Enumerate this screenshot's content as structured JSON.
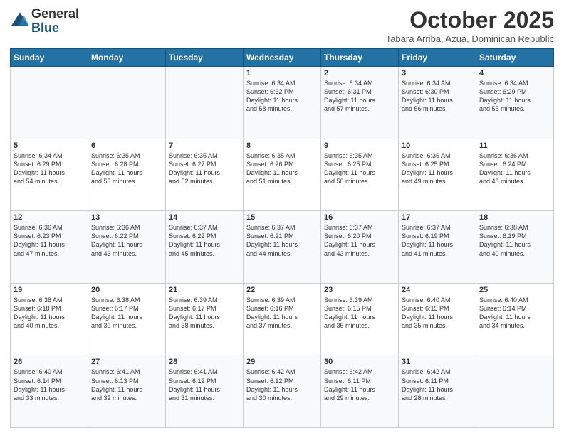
{
  "header": {
    "logo_general": "General",
    "logo_blue": "Blue",
    "month_title": "October 2025",
    "subtitle": "Tabara Arriba, Azua, Dominican Republic"
  },
  "weekdays": [
    "Sunday",
    "Monday",
    "Tuesday",
    "Wednesday",
    "Thursday",
    "Friday",
    "Saturday"
  ],
  "weeks": [
    [
      {
        "day": "",
        "info": ""
      },
      {
        "day": "",
        "info": ""
      },
      {
        "day": "",
        "info": ""
      },
      {
        "day": "1",
        "info": "Sunrise: 6:34 AM\nSunset: 6:32 PM\nDaylight: 11 hours\nand 58 minutes."
      },
      {
        "day": "2",
        "info": "Sunrise: 6:34 AM\nSunset: 6:31 PM\nDaylight: 11 hours\nand 57 minutes."
      },
      {
        "day": "3",
        "info": "Sunrise: 6:34 AM\nSunset: 6:30 PM\nDaylight: 11 hours\nand 56 minutes."
      },
      {
        "day": "4",
        "info": "Sunrise: 6:34 AM\nSunset: 6:29 PM\nDaylight: 11 hours\nand 55 minutes."
      }
    ],
    [
      {
        "day": "5",
        "info": "Sunrise: 6:34 AM\nSunset: 6:29 PM\nDaylight: 11 hours\nand 54 minutes."
      },
      {
        "day": "6",
        "info": "Sunrise: 6:35 AM\nSunset: 6:28 PM\nDaylight: 11 hours\nand 53 minutes."
      },
      {
        "day": "7",
        "info": "Sunrise: 6:35 AM\nSunset: 6:27 PM\nDaylight: 11 hours\nand 52 minutes."
      },
      {
        "day": "8",
        "info": "Sunrise: 6:35 AM\nSunset: 6:26 PM\nDaylight: 11 hours\nand 51 minutes."
      },
      {
        "day": "9",
        "info": "Sunrise: 6:35 AM\nSunset: 6:25 PM\nDaylight: 11 hours\nand 50 minutes."
      },
      {
        "day": "10",
        "info": "Sunrise: 6:36 AM\nSunset: 6:25 PM\nDaylight: 11 hours\nand 49 minutes."
      },
      {
        "day": "11",
        "info": "Sunrise: 6:36 AM\nSunset: 6:24 PM\nDaylight: 11 hours\nand 48 minutes."
      }
    ],
    [
      {
        "day": "12",
        "info": "Sunrise: 6:36 AM\nSunset: 6:23 PM\nDaylight: 11 hours\nand 47 minutes."
      },
      {
        "day": "13",
        "info": "Sunrise: 6:36 AM\nSunset: 6:22 PM\nDaylight: 11 hours\nand 46 minutes."
      },
      {
        "day": "14",
        "info": "Sunrise: 6:37 AM\nSunset: 6:22 PM\nDaylight: 11 hours\nand 45 minutes."
      },
      {
        "day": "15",
        "info": "Sunrise: 6:37 AM\nSunset: 6:21 PM\nDaylight: 11 hours\nand 44 minutes."
      },
      {
        "day": "16",
        "info": "Sunrise: 6:37 AM\nSunset: 6:20 PM\nDaylight: 11 hours\nand 43 minutes."
      },
      {
        "day": "17",
        "info": "Sunrise: 6:37 AM\nSunset: 6:19 PM\nDaylight: 11 hours\nand 41 minutes."
      },
      {
        "day": "18",
        "info": "Sunrise: 6:38 AM\nSunset: 6:19 PM\nDaylight: 11 hours\nand 40 minutes."
      }
    ],
    [
      {
        "day": "19",
        "info": "Sunrise: 6:38 AM\nSunset: 6:18 PM\nDaylight: 11 hours\nand 40 minutes."
      },
      {
        "day": "20",
        "info": "Sunrise: 6:38 AM\nSunset: 6:17 PM\nDaylight: 11 hours\nand 39 minutes."
      },
      {
        "day": "21",
        "info": "Sunrise: 6:39 AM\nSunset: 6:17 PM\nDaylight: 11 hours\nand 38 minutes."
      },
      {
        "day": "22",
        "info": "Sunrise: 6:39 AM\nSunset: 6:16 PM\nDaylight: 11 hours\nand 37 minutes."
      },
      {
        "day": "23",
        "info": "Sunrise: 6:39 AM\nSunset: 6:15 PM\nDaylight: 11 hours\nand 36 minutes."
      },
      {
        "day": "24",
        "info": "Sunrise: 6:40 AM\nSunset: 6:15 PM\nDaylight: 11 hours\nand 35 minutes."
      },
      {
        "day": "25",
        "info": "Sunrise: 6:40 AM\nSunset: 6:14 PM\nDaylight: 11 hours\nand 34 minutes."
      }
    ],
    [
      {
        "day": "26",
        "info": "Sunrise: 6:40 AM\nSunset: 6:14 PM\nDaylight: 11 hours\nand 33 minutes."
      },
      {
        "day": "27",
        "info": "Sunrise: 6:41 AM\nSunset: 6:13 PM\nDaylight: 11 hours\nand 32 minutes."
      },
      {
        "day": "28",
        "info": "Sunrise: 6:41 AM\nSunset: 6:12 PM\nDaylight: 11 hours\nand 31 minutes."
      },
      {
        "day": "29",
        "info": "Sunrise: 6:42 AM\nSunset: 6:12 PM\nDaylight: 11 hours\nand 30 minutes."
      },
      {
        "day": "30",
        "info": "Sunrise: 6:42 AM\nSunset: 6:11 PM\nDaylight: 11 hours\nand 29 minutes."
      },
      {
        "day": "31",
        "info": "Sunrise: 6:42 AM\nSunset: 6:11 PM\nDaylight: 11 hours\nand 28 minutes."
      },
      {
        "day": "",
        "info": ""
      }
    ]
  ]
}
